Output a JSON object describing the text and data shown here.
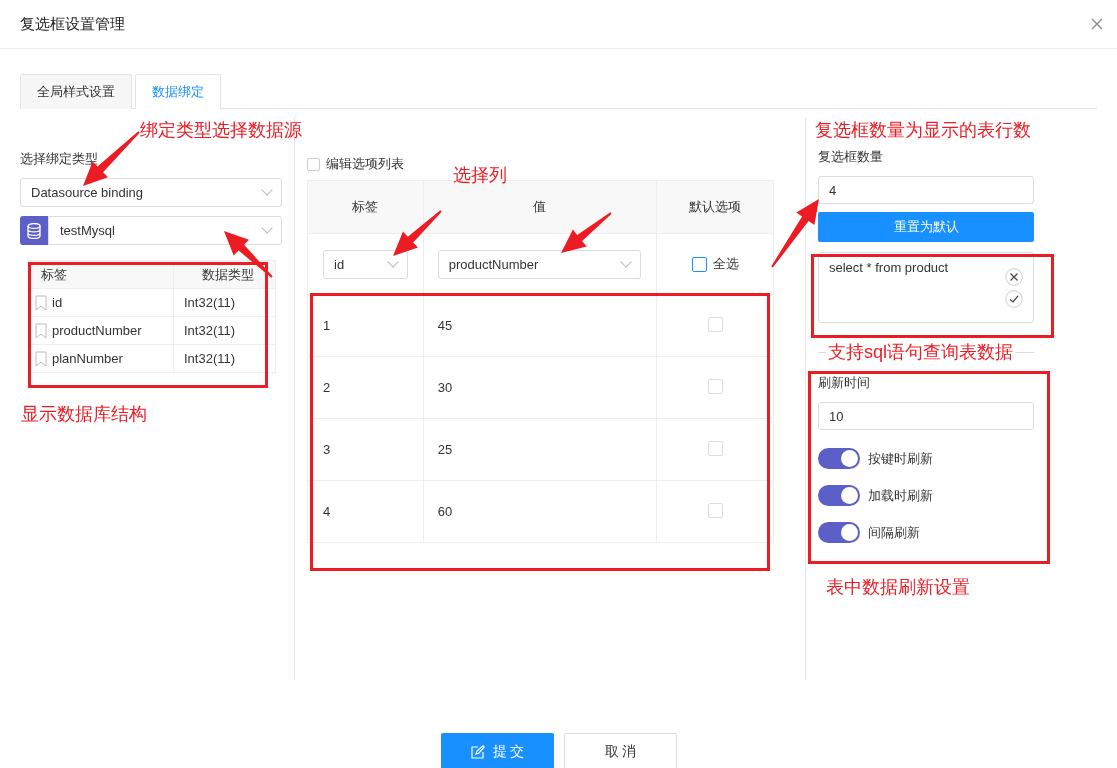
{
  "window": {
    "title": "复选框设置管理"
  },
  "tabs": [
    {
      "label": "全局样式设置",
      "selected": false
    },
    {
      "label": "数据绑定",
      "selected": true
    }
  ],
  "left": {
    "label": "选择绑定类型",
    "binding_type": "Datasource binding",
    "datasource": "testMysql",
    "columns": [
      "标签",
      "数据类型"
    ],
    "fields": [
      {
        "name": "id",
        "type": "Int32(11)"
      },
      {
        "name": "productNumber",
        "type": "Int32(11)"
      },
      {
        "name": "planNumber",
        "type": "Int32(11)"
      }
    ]
  },
  "middle": {
    "edit_list": {
      "label": "编辑选项列表",
      "checked": false
    },
    "columns": [
      "标签",
      "值",
      "默认选项"
    ],
    "label_column": "id",
    "value_column": "productNumber",
    "select_all": {
      "label": "全选",
      "checked": false
    },
    "rows": [
      {
        "label": "1",
        "value": "45",
        "checked": false
      },
      {
        "label": "2",
        "value": "30",
        "checked": false
      },
      {
        "label": "3",
        "value": "25",
        "checked": false
      },
      {
        "label": "4",
        "value": "60",
        "checked": false
      }
    ]
  },
  "right": {
    "count_label": "复选框数量",
    "count": "4",
    "reset_button": "重置为默认",
    "sql": "select * from product",
    "refresh_label": "刷新时间",
    "refresh_time": "10",
    "toggles": [
      {
        "label": "按键时刷新",
        "on": true
      },
      {
        "label": "加载时刷新",
        "on": true
      },
      {
        "label": "间隔刷新",
        "on": true
      }
    ]
  },
  "buttons": {
    "submit": "提 交",
    "cancel": "取 消"
  },
  "annotations": [
    "绑定类型选择数据源",
    "显示数据库结构",
    "选择列",
    "复选框数量为显示的表行数",
    "支持sql语句查询表数据",
    "表中数据刷新设置"
  ]
}
